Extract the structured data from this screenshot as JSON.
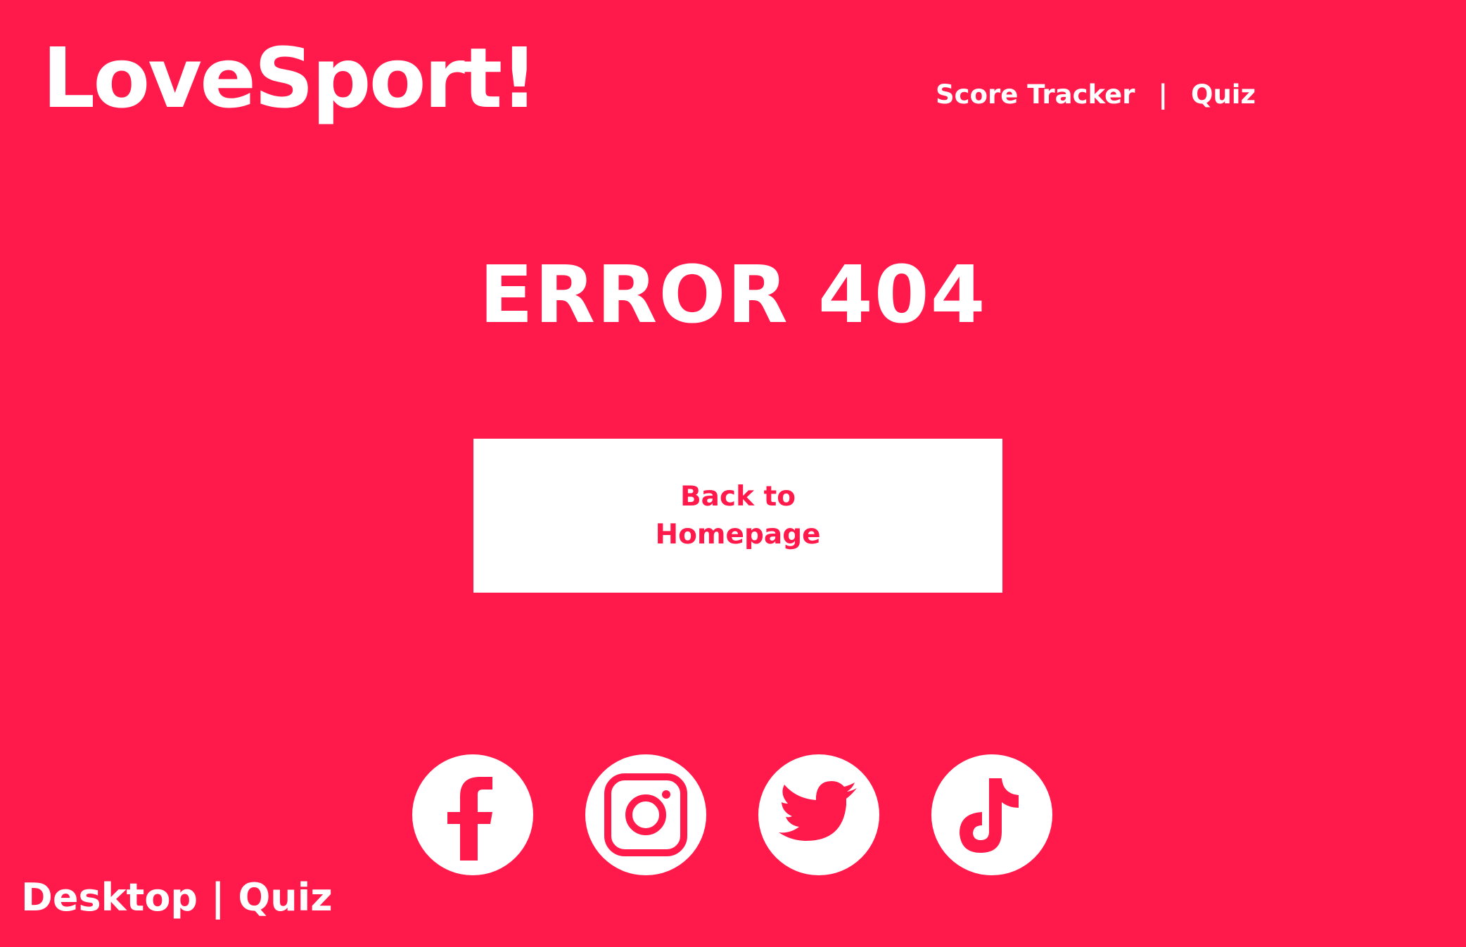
{
  "brand": {
    "logo": "LoveSport!",
    "background_color": "#FF1A4B",
    "foreground_color": "#FFFFFF"
  },
  "nav": {
    "score_tracker": "Score Tracker",
    "separator": "|",
    "quiz": "Quiz"
  },
  "main": {
    "error_title": "ERROR 404",
    "back_button_line1": "Back to",
    "back_button_line2": "Homepage"
  },
  "social": [
    {
      "icon": "facebook-icon"
    },
    {
      "icon": "instagram-icon"
    },
    {
      "icon": "twitter-icon"
    },
    {
      "icon": "tiktok-icon"
    }
  ],
  "footer": {
    "label": "Desktop | Quiz"
  }
}
